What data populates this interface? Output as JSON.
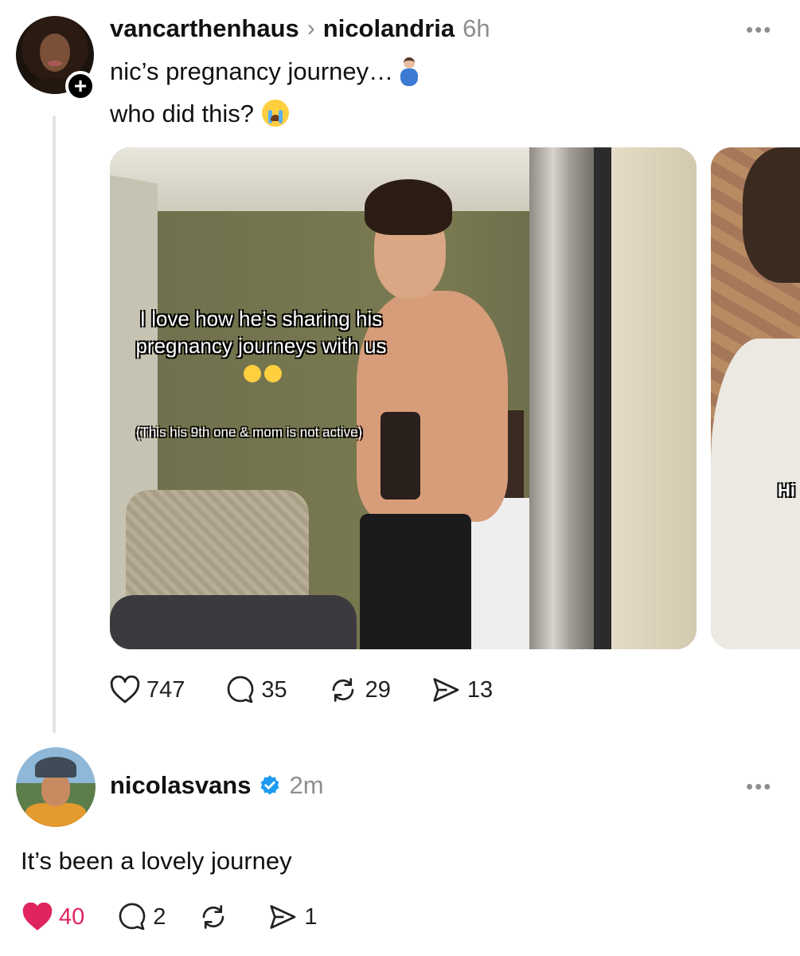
{
  "post": {
    "author": "vancarthenhaus",
    "reply_to": "nicolandria",
    "separator": "›",
    "time": "6h",
    "more": "•••",
    "follow_icon": "+",
    "text_line1": "nic’s pregnancy journey…",
    "text_line2": "who did this?",
    "media_caption_main": "I love how he’s sharing his pregnancy journeys with us",
    "media_caption_sub": "(This his 9th one & mom is not active)",
    "media2_caption": "Hi",
    "stats": {
      "likes": "747",
      "comments": "35",
      "reposts": "29",
      "shares": "13"
    }
  },
  "reply": {
    "author": "nicolasvans",
    "time": "2m",
    "more": "•••",
    "text": "It’s been a lovely journey",
    "stats": {
      "likes": "40",
      "comments": "2",
      "reposts": "",
      "shares": "1"
    }
  },
  "colors": {
    "like_active": "#e0245e",
    "verified": "#1d9bf0",
    "muted": "#8e8e8e"
  },
  "icons": [
    "heart-icon",
    "comment-icon",
    "repost-icon",
    "share-icon",
    "verified-badge-icon",
    "more-icon",
    "plus-icon"
  ]
}
